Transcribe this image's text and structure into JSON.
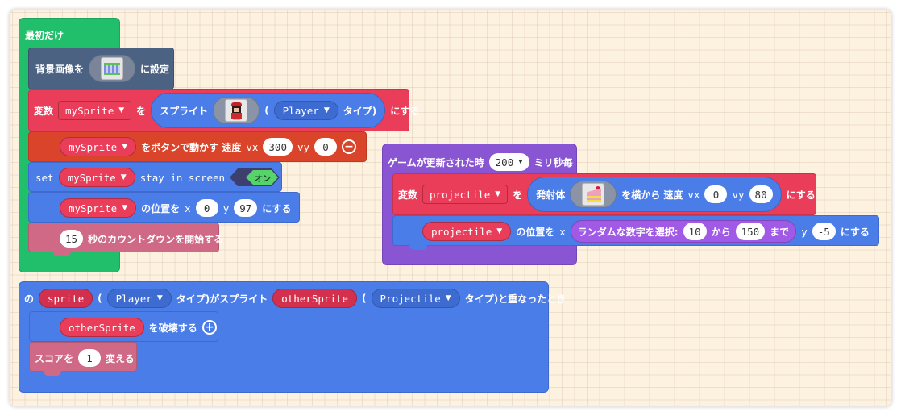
{
  "workspace": {
    "on_start": {
      "hat_label": "最初だけ",
      "set_background": {
        "prefix": "背景画像を",
        "suffix": "に設定",
        "image_icon": "background-image-thumbnail"
      },
      "create_sprite": {
        "kw_variable": "変数",
        "variable": "mySprite",
        "kw_wo": "を",
        "sprite_label": "スプライト",
        "image_icon": "player-sprite-thumbnail",
        "paren_open": "(",
        "kind": "Player",
        "kind_suffix": "タイプ)",
        "suffix": "にする"
      },
      "move_with_buttons": {
        "variable": "mySprite",
        "label": "をボタンで動かす 速度",
        "vx_label": "vx",
        "vx": "300",
        "vy_label": "vy",
        "vy": "0"
      },
      "stay_in_screen": {
        "kw_set": "set",
        "variable": "mySprite",
        "label": "stay in screen",
        "toggle_label": "オン",
        "toggle_on": true
      },
      "set_position": {
        "variable": "mySprite",
        "label": "の位置を",
        "x_label": "x",
        "x": "0",
        "y_label": "y",
        "y": "97",
        "suffix": "にする"
      },
      "countdown": {
        "seconds": "15",
        "label": "秒のカウントダウンを開始する"
      }
    },
    "on_update_interval": {
      "prefix": "ゲームが更新された時",
      "interval": "200",
      "suffix": "ミリ秒毎",
      "create_projectile": {
        "kw_variable": "変数",
        "variable": "projectile",
        "kw_wo": "を",
        "label": "発射体",
        "image_icon": "cake-sprite-thumbnail",
        "from_side": "を横から 速度",
        "vx_label": "vx",
        "vx": "0",
        "vy_label": "vy",
        "vy": "80",
        "suffix": "にする"
      },
      "set_position": {
        "variable": "projectile",
        "label": "の位置を",
        "x_label": "x",
        "random_label": "ランダムな数字を選択:",
        "random_min": "10",
        "random_from": "から",
        "random_max": "150",
        "random_to": "まで",
        "y_label": "y",
        "y": "-5",
        "suffix": "にする"
      }
    },
    "on_overlap": {
      "kw_no": "の",
      "sprite_var": "sprite",
      "paren1": "(",
      "kind1": "Player",
      "mid": "タイプ)がスプライト",
      "other_var": "otherSprite",
      "paren2": "(",
      "kind2": "Projectile",
      "end": "タイプ)と重なったとき",
      "destroy": {
        "variable": "otherSprite",
        "label": "を破壊する"
      },
      "change_score": {
        "prefix": "スコアを",
        "value": "1",
        "suffix": "変える"
      }
    }
  }
}
